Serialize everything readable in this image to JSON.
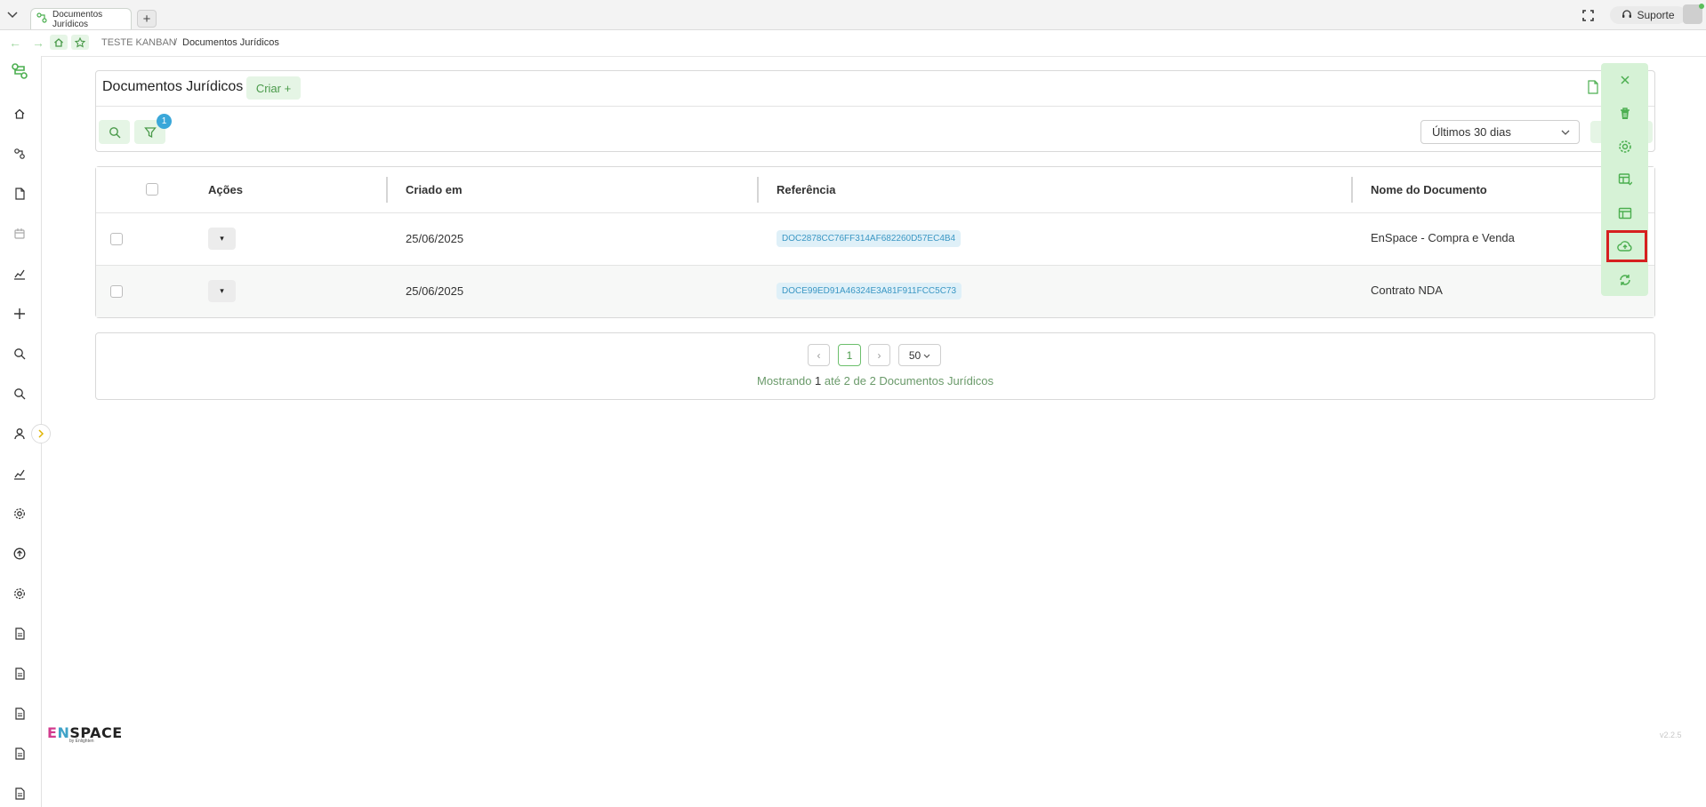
{
  "browser": {
    "tab_title": "Documentos Jurídicos",
    "new_tab_label": "+",
    "support_label": "Suporte"
  },
  "breadcrumb": {
    "root": "TESTE KANBAN",
    "separator": "/",
    "current": "Documentos Jurídicos"
  },
  "header": {
    "title": "Documentos Jurídicos",
    "create_label": "Criar +",
    "filter_count": "1",
    "period_value": "Últimos 30 dias"
  },
  "table": {
    "columns": [
      "Ações",
      "Criado em",
      "Referência",
      "Nome do Documento"
    ],
    "rows": [
      {
        "created": "25/06/2025",
        "reference": "DOC2878CC76FF314AF682260D57EC4B4",
        "name": "EnSpace - Compra e Venda"
      },
      {
        "created": "25/06/2025",
        "reference": "DOCE99ED91A46324E3A81F911FCC5C73",
        "name": "Contrato NDA"
      }
    ],
    "action_caret": "▾"
  },
  "pagination": {
    "prev": "‹",
    "current_page": "1",
    "next": "›",
    "page_size": "50",
    "summary_prefix": "Mostrando",
    "summary_from": "1",
    "summary_mid1": "até",
    "summary_to": "2",
    "summary_mid2": "de",
    "summary_total": "2",
    "summary_suffix": "Documentos Jurídicos"
  },
  "brand": {
    "name_e": "E",
    "name_n": "N",
    "name_rest": "SPACE",
    "sub": "by Enlighten"
  },
  "version": "v2.2.5",
  "toolbar_icons": [
    "close-icon",
    "trash-icon",
    "gear-icon",
    "table-settings-icon",
    "layout-icon",
    "cloud-upload-icon",
    "refresh-icon"
  ],
  "sidebar_icons": [
    "logo-icon",
    "home-icon",
    "workflow-icon",
    "document-icon",
    "calendar-icon",
    "chart-icon",
    "plus-icon",
    "search-icon",
    "search-icon",
    "user-icon",
    "chart-icon",
    "gear-icon",
    "upload-circle-icon",
    "gear-icon",
    "file-icon",
    "file-icon",
    "file-icon",
    "file-icon",
    "file-icon"
  ],
  "colors": {
    "accent_green": "#4a9a4a",
    "light_green": "#e5f5e5",
    "toolbar_green": "#d6f2d6",
    "highlight_red": "#d62020",
    "badge_blue": "#3aa7d9"
  }
}
